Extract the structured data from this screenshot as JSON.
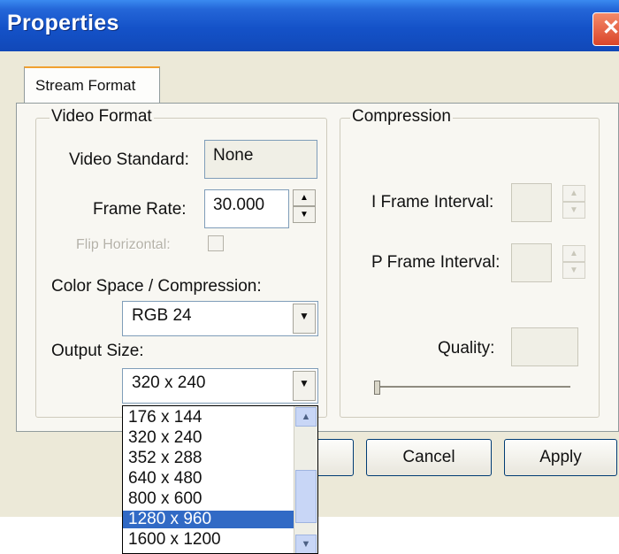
{
  "window": {
    "title": "Properties",
    "close_glyph": "✕"
  },
  "tabs": [
    {
      "label": "Stream Format"
    }
  ],
  "video_format": {
    "legend": "Video Format",
    "video_standard_label": "Video Standard:",
    "video_standard_value": "None",
    "frame_rate_label": "Frame Rate:",
    "frame_rate_value": "30.000",
    "flip_horizontal_label": "Flip Horizontal:",
    "color_space_label": "Color Space / Compression:",
    "color_space_value": "RGB 24",
    "output_size_label": "Output Size:",
    "output_size_value": "320 x 240"
  },
  "compression": {
    "legend": "Compression",
    "i_frame_label": "I Frame Interval:",
    "p_frame_label": "P Frame Interval:",
    "quality_label": "Quality:",
    "quality_slider_value": 0
  },
  "buttons": {
    "ok": "",
    "cancel": "Cancel",
    "apply": "Apply"
  },
  "output_size_options": [
    "176 x 144",
    "320 x 240",
    "352 x 288",
    "640 x 480",
    "800 x 600",
    "1280 x 960",
    "1600 x 1200"
  ],
  "output_size_highlighted": "1280 x 960",
  "icons": {
    "spin_up": "▲",
    "spin_down": "▼",
    "combo_arrow": "▼",
    "scroll_up": "▲",
    "scroll_down": "▼"
  },
  "colors": {
    "titlebar": "#1452c8",
    "selection": "#316ac5",
    "close_button": "#d9452a"
  }
}
